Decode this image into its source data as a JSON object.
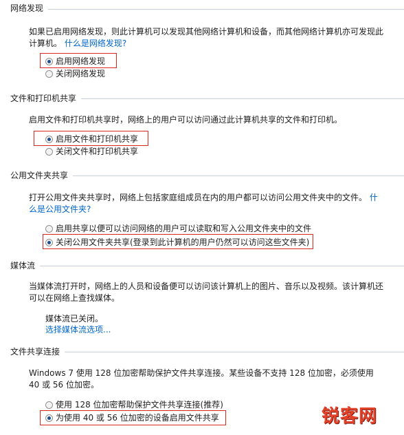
{
  "network_discovery": {
    "title": "网络发现",
    "desc_text": "如果已启用网络发现，则此计算机可以发现其他网络计算机和设备，而其他网络计算机亦可发现此计算机。",
    "desc_link": "什么是网络发现?",
    "options": [
      {
        "label": "启用网络发现",
        "checked": true
      },
      {
        "label": "关闭网络发现",
        "checked": false
      }
    ]
  },
  "file_printer_sharing": {
    "title": "文件和打印机共享",
    "desc_text": "启用文件和打印机共享时，网络上的用户可以访问通过此计算机共享的文件和打印机。",
    "options": [
      {
        "label": "启用文件和打印机共享",
        "checked": true
      },
      {
        "label": "关闭文件和打印机共享",
        "checked": false
      }
    ]
  },
  "public_folder_sharing": {
    "title": "公用文件夹共享",
    "desc_text": "打开公用文件夹共享时，网络上包括家庭组成员在内的用户都可以访问公用文件夹中的文件。",
    "desc_link": "什么是公用文件夹?",
    "options": [
      {
        "label": "启用共享以便可以访问网络的用户可以读取和写入公用文件夹中的文件",
        "checked": false
      },
      {
        "label": "关闭公用文件夹共享(登录到此计算机的用户仍然可以访问这些文件夹)",
        "checked": true
      }
    ]
  },
  "media_streaming": {
    "title": "媒体流",
    "desc_text": "当媒体流打开时，网络上的人员和设备便可以访问该计算机上的图片、音乐以及视频。该计算机还可以在网络上查找媒体。",
    "status": "媒体流已关闭。",
    "link": "选择媒体流选项..."
  },
  "file_sharing_connections": {
    "title": "文件共享连接",
    "desc_text": "Windows 7 使用 128 位加密帮助保护文件共享连接。某些设备不支持 128 位加密，必须使用 40 或 56 位加密。",
    "options": [
      {
        "label": "使用 128 位加密帮助保护文件共享连接(推荐)",
        "checked": false
      },
      {
        "label": "为使用 40 或 56 位加密的设备启用文件共享",
        "checked": true
      }
    ]
  },
  "watermark": "锐客网"
}
